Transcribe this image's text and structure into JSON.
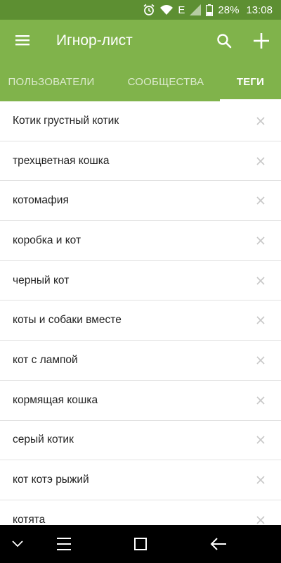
{
  "status_bar": {
    "network_label": "E",
    "battery": "28%",
    "time": "13:08",
    "icons": [
      "alarm-icon",
      "wifi-icon",
      "signal-icon",
      "battery-icon"
    ]
  },
  "app_bar": {
    "title": "Игнор-лист",
    "icons": [
      "menu-icon",
      "search-icon",
      "plus-icon"
    ],
    "background": "#80b34b",
    "status_background": "#5d8f32"
  },
  "tabs": [
    {
      "label": "ПОЛЬЗОВАТЕЛИ",
      "active": false
    },
    {
      "label": "СООБЩЕСТВА",
      "active": false
    },
    {
      "label": "ТЕГИ",
      "active": true
    }
  ],
  "tags": [
    "Котик грустный котик",
    "трехцветная кошка",
    "котомафия",
    "коробка и кот",
    "черный кот",
    "коты и собаки вместе",
    "кот с лампой",
    "кормящая кошка",
    "серый котик",
    "кот котэ рыжий",
    "котята"
  ],
  "remove_icon": "close-icon",
  "nav_bar": {
    "icons": [
      "chevron-down-icon",
      "menu-icon",
      "recents-icon",
      "back-icon"
    ]
  }
}
